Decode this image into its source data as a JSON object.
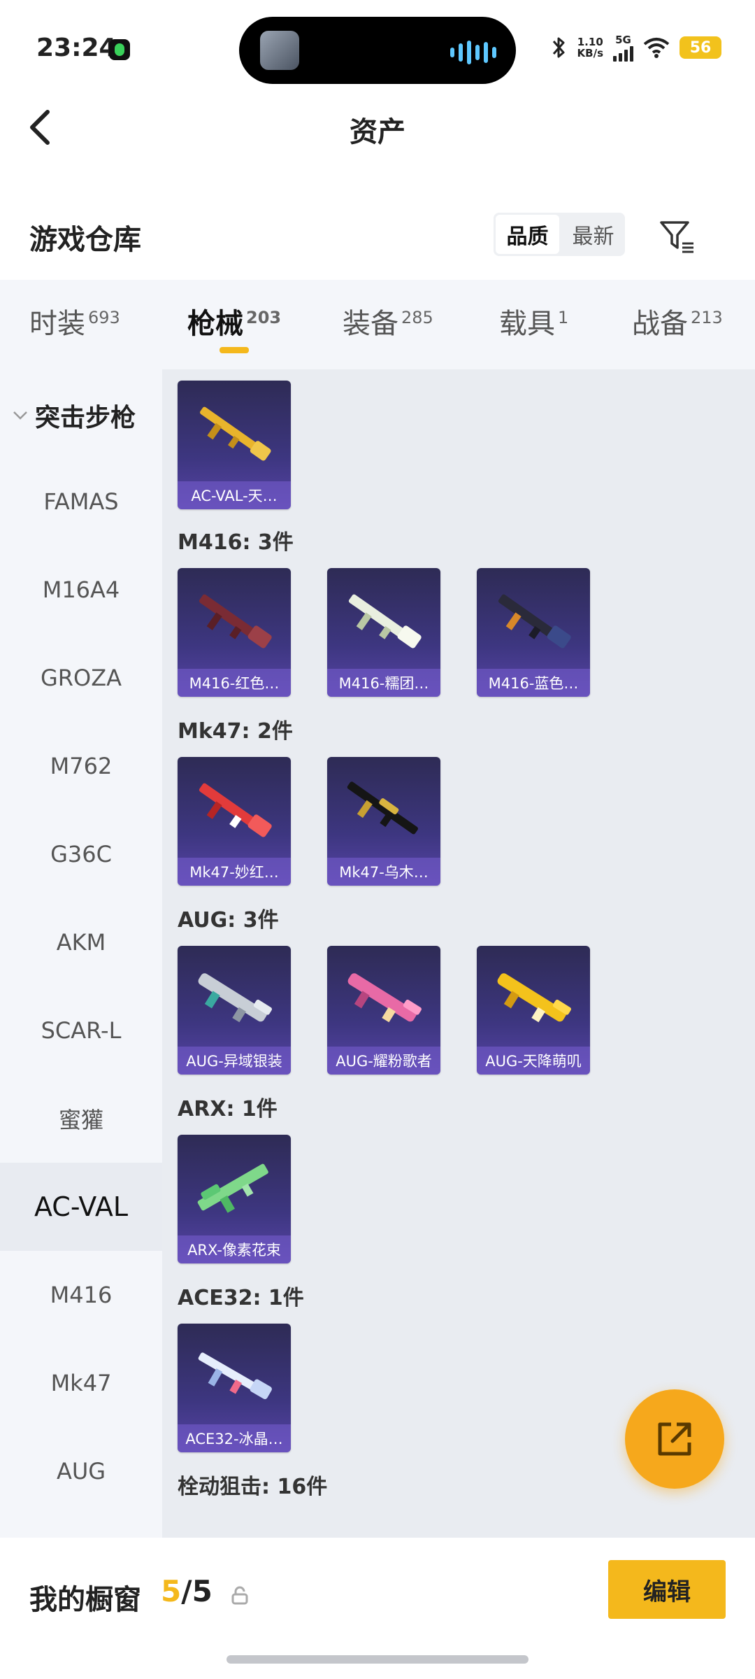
{
  "status_bar": {
    "time": "23:24",
    "net_speed_value": "1.10",
    "net_speed_unit": "KB/s",
    "network": "5G",
    "battery": "56"
  },
  "header": {
    "title": "资产"
  },
  "warehouse": {
    "title": "游戏仓库",
    "sort_options": [
      "品质",
      "最新"
    ],
    "active_sort": "品质"
  },
  "tabs": [
    {
      "label": "时装",
      "count": "693"
    },
    {
      "label": "枪械",
      "count": "203"
    },
    {
      "label": "装备",
      "count": "285"
    },
    {
      "label": "载具",
      "count": "1"
    },
    {
      "label": "战备",
      "count": "213"
    }
  ],
  "active_tab": "枪械",
  "sidebar": {
    "category": "突击步枪",
    "items": [
      "FAMAS",
      "M16A4",
      "GROZA",
      "M762",
      "G36C",
      "AKM",
      "SCAR-L",
      "蜜獾",
      "AC-VAL",
      "M416",
      "Mk47",
      "AUG"
    ],
    "active_item": "AC-VAL"
  },
  "groups": [
    {
      "label": "",
      "items": [
        "AC-VAL-天…"
      ]
    },
    {
      "label": "M416: 3件",
      "items": [
        "M416-红色…",
        "M416-糯团…",
        "M416-蓝色…"
      ]
    },
    {
      "label": "Mk47: 2件",
      "items": [
        "Mk47-妙红…",
        "Mk47-乌木…"
      ]
    },
    {
      "label": "AUG: 3件",
      "items": [
        "AUG-异域银装",
        "AUG-耀粉歌者",
        "AUG-天降萌叽"
      ]
    },
    {
      "label": "ARX: 1件",
      "items": [
        "ARX-像素花束"
      ]
    },
    {
      "label": "ACE32: 1件",
      "items": [
        "ACE32-冰晶…"
      ]
    },
    {
      "label": "栓动狙击: 16件",
      "items": []
    }
  ],
  "bottom_bar": {
    "title": "我的橱窗",
    "current": "5",
    "separator": "/",
    "total": "5",
    "edit_label": "编辑"
  },
  "colors": {
    "accent": "#f4b81c",
    "fab": "#f6a81c",
    "card_bg": "#3d3680"
  }
}
